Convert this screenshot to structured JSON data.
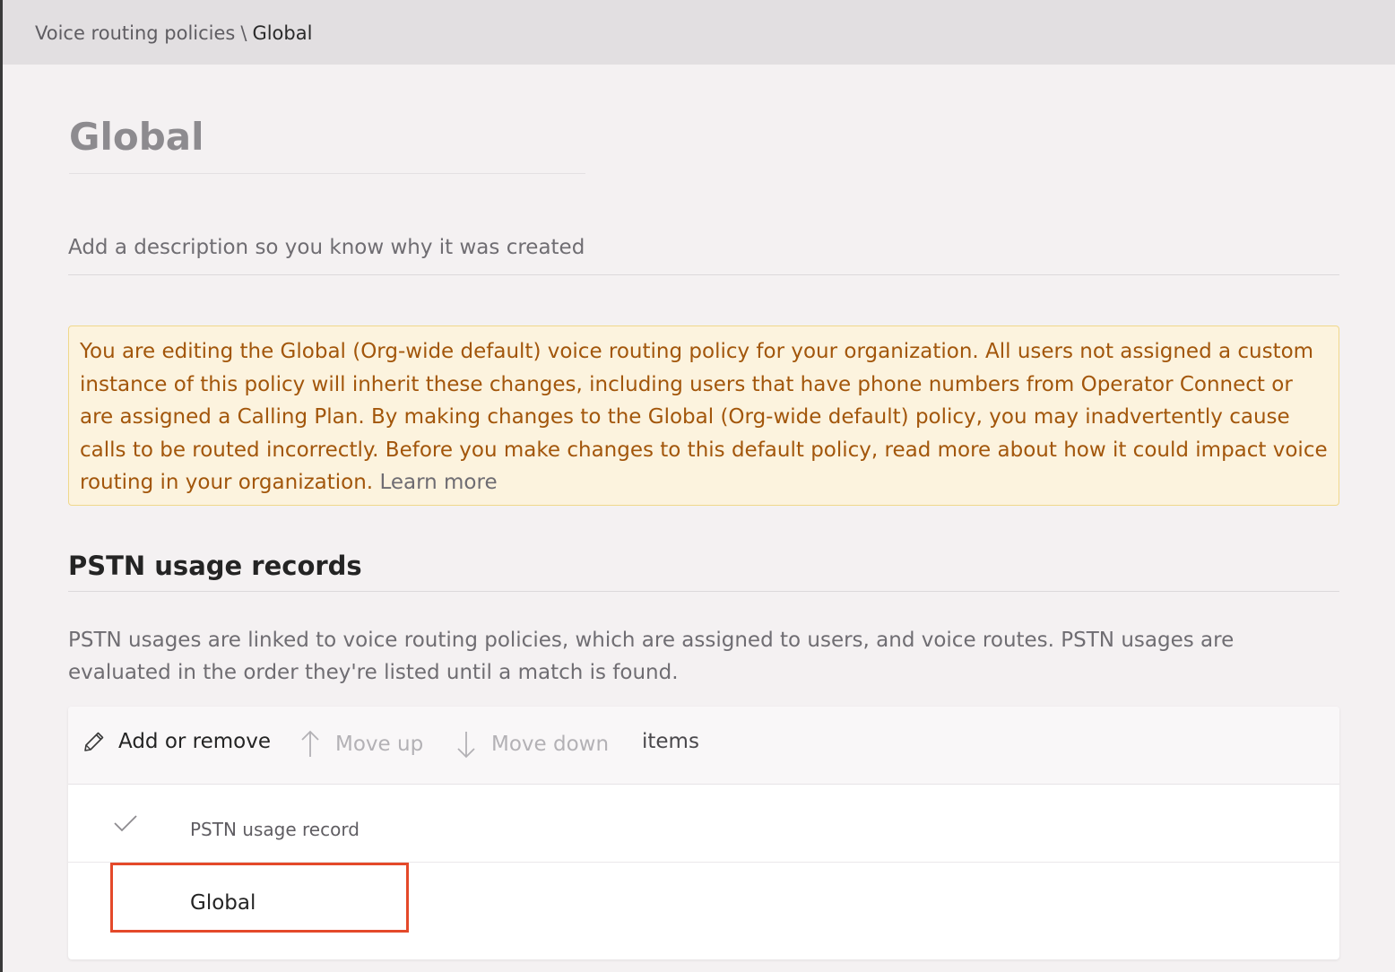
{
  "breadcrumb": {
    "parent": "Voice routing policies",
    "separator": "\\",
    "current": "Global"
  },
  "policy": {
    "title": "Global",
    "description_placeholder": "Add a description so you know why it was created"
  },
  "warning": {
    "text": "You are editing the Global (Org-wide default) voice routing policy for your organization. All users not assigned a custom instance of this policy will inherit these changes, including users that have phone numbers from Operator Connect or are assigned a Calling Plan. By making changes to the Global (Org-wide default) policy, you may inadvertently cause calls to be routed incorrectly. Before you make changes to this default policy, read more about how it could impact voice routing in your organization.",
    "link_label": "Learn more",
    "colors": {
      "background": "#fcf3de",
      "border": "#f0d88c",
      "text": "#a2560b"
    }
  },
  "pstn": {
    "section_title": "PSTN usage records",
    "section_description": "PSTN usages are linked to voice routing policies, which are assigned to users, and voice routes. PSTN usages are evaluated in the order they're listed until a match is found.",
    "toolbar": {
      "add_remove_label": "Add or remove",
      "add_remove_icon": "pencil-icon",
      "move_up_label": "Move up",
      "move_up_icon": "arrow-up-icon",
      "move_down_label": "Move down",
      "move_down_icon": "arrow-down-icon",
      "items_label": "items"
    },
    "table": {
      "select_all_icon": "checkmark-icon",
      "columns": [
        "PSTN usage record"
      ],
      "rows": [
        {
          "record": "Global",
          "highlighted": true
        }
      ]
    }
  },
  "colors": {
    "highlight_border": "#e4492a",
    "page_background": "#f4f1f2",
    "topbar_background": "#e2dfe1"
  }
}
